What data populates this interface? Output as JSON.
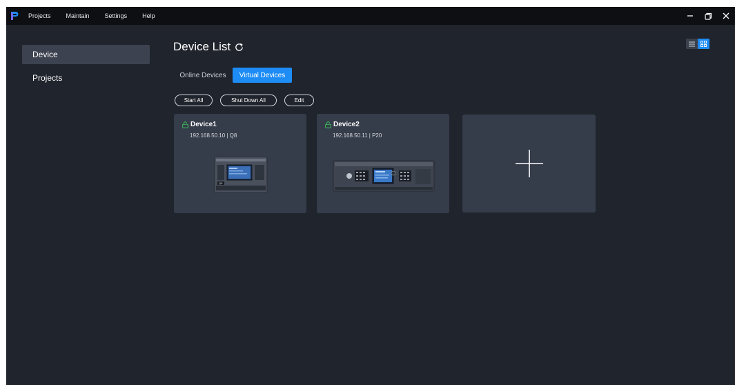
{
  "menu": {
    "items": [
      {
        "label": "Projects"
      },
      {
        "label": "Maintain"
      },
      {
        "label": "Settings"
      },
      {
        "label": "Help"
      }
    ]
  },
  "sidebar": {
    "items": [
      {
        "label": "Device",
        "active": true
      },
      {
        "label": "Projects",
        "active": false
      }
    ]
  },
  "main": {
    "title": "Device List",
    "tabs": [
      {
        "label": "Online Devices",
        "active": false
      },
      {
        "label": "Virtual Devices",
        "active": true
      }
    ],
    "actions": {
      "start_all": "Start All",
      "shut_down_all": "Shut Down All",
      "edit": "Edit"
    },
    "devices": [
      {
        "name": "Device1",
        "info": "192.168.50.10 | Q8",
        "status_icon": "lock-open-icon"
      },
      {
        "name": "Device2",
        "info": "192.168.50.11 | P20",
        "status_icon": "lock-open-icon"
      }
    ],
    "add_card_icon": "plus-icon"
  },
  "colors": {
    "accent": "#1e8cf5",
    "background": "#20242c",
    "titlebar": "#0d0f13",
    "card": "#353c4a",
    "sidebar_active": "#3d4250",
    "status_green": "#3dbf5a"
  },
  "view_toggle": {
    "list_icon": "list-view-icon",
    "grid_icon": "grid-view-icon",
    "active": "grid"
  }
}
